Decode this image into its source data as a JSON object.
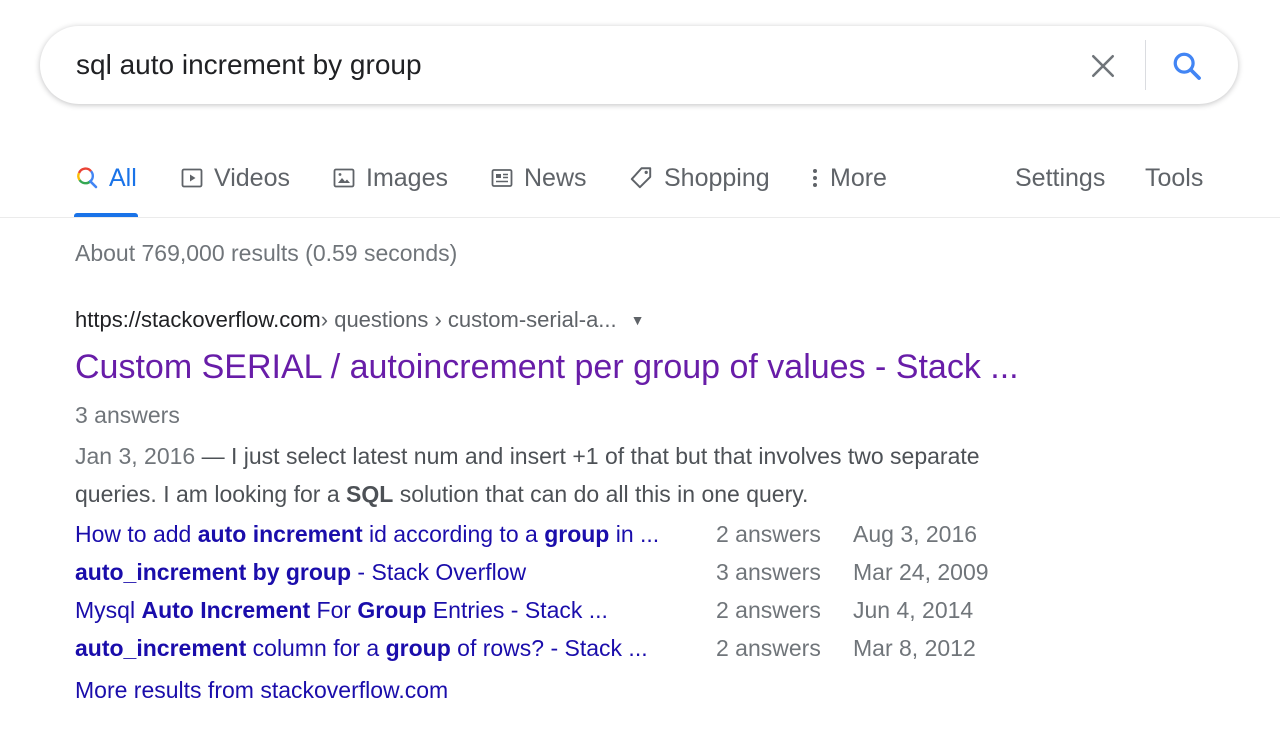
{
  "search": {
    "query": "sql auto increment by group",
    "clear_icon": "close-icon",
    "search_icon": "search-icon"
  },
  "tabs": {
    "all": "All",
    "videos": "Videos",
    "images": "Images",
    "news": "News",
    "shopping": "Shopping",
    "more": "More",
    "settings": "Settings",
    "tools": "Tools"
  },
  "stats": "About 769,000 results (0.59 seconds)",
  "result": {
    "domain": "https://stackoverflow.com",
    "path": " › questions › custom-serial-a...",
    "title": "Custom SERIAL / autoincrement per group of values - Stack ...",
    "answers": "3 answers",
    "snippet_date": "Jan 3, 2016",
    "snippet_sep": " — ",
    "snippet_part1": "I just select latest num and insert +1 of that but that involves two separate queries. I am looking for a ",
    "snippet_bold": "SQL",
    "snippet_part2": " solution that can do all this in one query.",
    "sitelinks": [
      {
        "t1": "How to add ",
        "b1": "auto increment",
        "t2": " id according to a ",
        "b2": "group",
        "t3": " in ...",
        "answers": "2 answers",
        "date": "Aug 3, 2016"
      },
      {
        "t1": "",
        "b1": "auto_increment by group",
        "t2": " - Stack Overflow",
        "b2": "",
        "t3": "",
        "answers": "3 answers",
        "date": "Mar 24, 2009"
      },
      {
        "t1": "Mysql ",
        "b1": "Auto Increment",
        "t2": " For ",
        "b2": "Group",
        "t3": " Entries - Stack ...",
        "answers": "2 answers",
        "date": "Jun 4, 2014"
      },
      {
        "t1": "",
        "b1": "auto_increment",
        "t2": " column for a ",
        "b2": "group",
        "t3": " of rows? - Stack ...",
        "answers": "2 answers",
        "date": "Mar 8, 2012"
      }
    ],
    "more_results": "More results from stackoverflow.com"
  },
  "colors": {
    "accent": "#1a73e8",
    "visited_title": "#681da8",
    "link": "#1a0dab",
    "muted": "#70757a"
  }
}
